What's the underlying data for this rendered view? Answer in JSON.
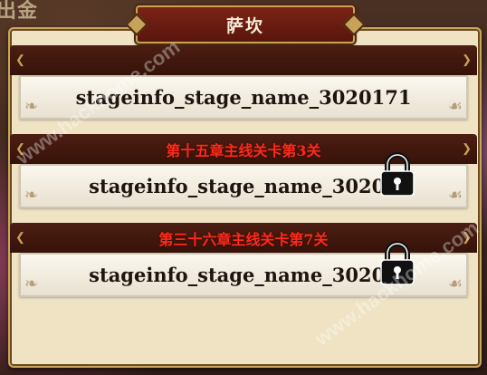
{
  "background_text": "出金",
  "title": "萨坎",
  "stages": [
    {
      "requirement": "",
      "name": "stageinfo_stage_name_3020171",
      "locked": false
    },
    {
      "requirement": "第十五章主线关卡第3关",
      "name": "stageinfo_stage_name_30201",
      "locked": true
    },
    {
      "requirement": "第三十六章主线关卡第7关",
      "name": "stageinfo_stage_name_30201",
      "locked": true
    }
  ],
  "watermark": [
    "www.hackhome.com",
    "www.hackhome.com"
  ],
  "colors": {
    "title_bg": "#6a1c10",
    "requirement_text": "#ff2a1a",
    "parchment": "#efe3c4"
  },
  "icons": {
    "lock": "padlock-icon"
  }
}
